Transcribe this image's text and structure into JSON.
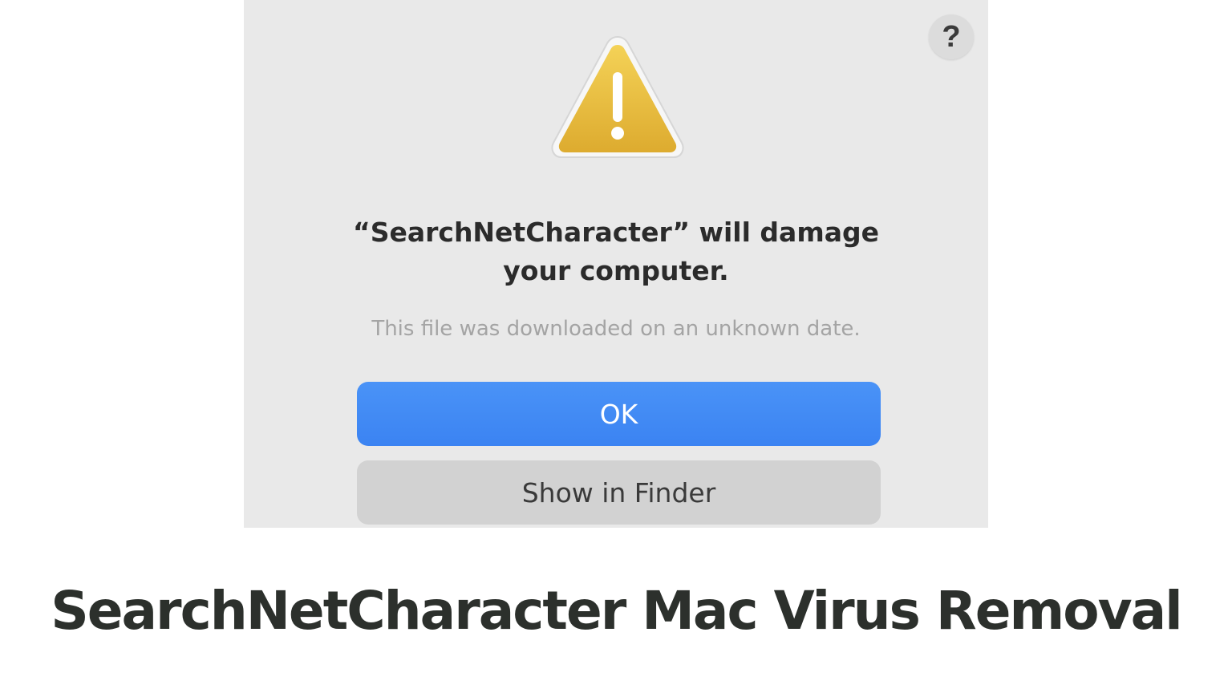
{
  "dialog": {
    "help_label": "?",
    "headline_line1": "“SearchNetCharacter” will damage",
    "headline_line2": "your computer.",
    "subtext": "This file was downloaded on an unknown date.",
    "ok_label": "OK",
    "finder_label": "Show in Finder",
    "icon": "warning-icon",
    "colors": {
      "background": "#e9e9e9",
      "ok_button": "#3b83f2",
      "finder_button": "#d2d2d2",
      "warning_yellow": "#e8b93a"
    }
  },
  "caption": {
    "title": "SearchNetCharacter Mac Virus Removal",
    "color": "#2c302c"
  }
}
